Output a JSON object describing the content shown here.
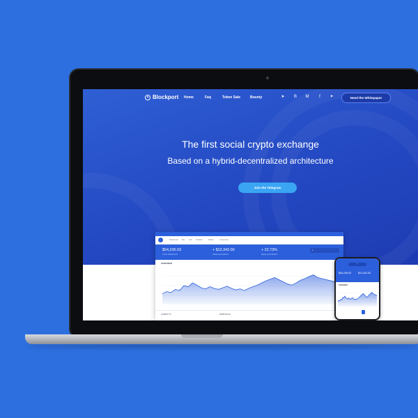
{
  "brand": {
    "name": "Blockport"
  },
  "nav": {
    "links": [
      "Home",
      "Faq",
      "Token Sale",
      "Bounty"
    ],
    "socials": [
      "telegram-icon",
      "bitcoin-icon",
      "medium-icon",
      "facebook-icon",
      "twitter-icon"
    ],
    "cta": "Need the Whitepaper"
  },
  "hero": {
    "title": "The first social crypto exchange",
    "subtitle": "Based on a hybrid-decentralized architecture",
    "cta": "Join the Telegram"
  },
  "dashboard": {
    "nav": [
      "Dashboard",
      "Buy",
      "Sell",
      "Portfolio",
      "Market",
      "Community"
    ],
    "stats": [
      {
        "value": "$54,236.03",
        "label": "TOTAL PORTFOLIO"
      },
      {
        "value": "+ $12,342.00",
        "label": "SINCE LAST MONTH"
      },
      {
        "value": "+ 22.73%",
        "label": "SINCE LAST MONTH"
      }
    ],
    "overview_label": "OVERVIEW",
    "footer": [
      "LATEST TX",
      "PORTFOLIO"
    ]
  },
  "phone": {
    "stats": [
      {
        "value": "$54,236.03"
      },
      {
        "value": "$12,342.00"
      }
    ],
    "overview_label": "OVERVIEW"
  },
  "colors": {
    "background": "#2d6fdf",
    "hero": "#2348c2",
    "accent": "#3aa5f3"
  },
  "chart_data": {
    "type": "area",
    "x": [
      0,
      1,
      2,
      3,
      4,
      5,
      6,
      7,
      8,
      9,
      10,
      11,
      12,
      13,
      14,
      15,
      16,
      17,
      18,
      19,
      20,
      21,
      22,
      23,
      24,
      25,
      26,
      27,
      28,
      29,
      30,
      31,
      32,
      33,
      34,
      35,
      36,
      37,
      38,
      39,
      40
    ],
    "values": [
      20,
      24,
      22,
      28,
      26,
      35,
      33,
      40,
      36,
      31,
      29,
      33,
      30,
      28,
      31,
      34,
      30,
      27,
      29,
      26,
      30,
      33,
      36,
      40,
      44,
      47,
      50,
      46,
      42,
      38,
      36,
      40,
      45,
      48,
      52,
      55,
      50,
      48,
      46,
      44,
      42
    ],
    "ylim": [
      0,
      70
    ],
    "grid": true
  }
}
